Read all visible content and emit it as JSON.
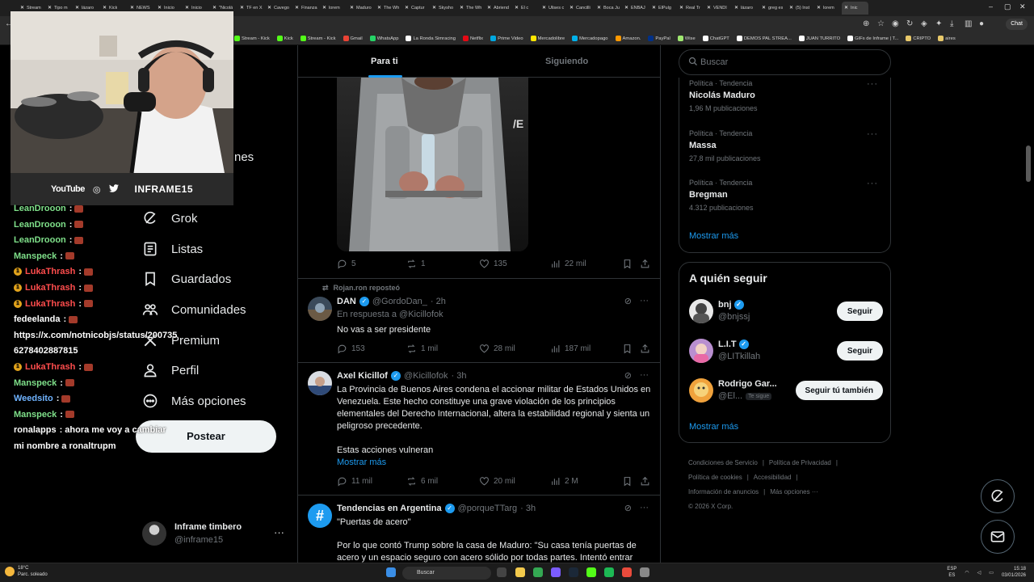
{
  "browser": {
    "tabs": [
      "Stream",
      "Tipo m",
      "lázaro",
      "Kick",
      "NEWS",
      "Inicio",
      "Inicio",
      "\"Nicolá",
      "TF en X",
      "Cavego",
      "Finanza",
      "lorem",
      "Maduro",
      "The Wh",
      "Captur",
      "Skysho",
      "The Wh",
      "Abriend",
      "El c",
      "Ulises c",
      "Cancilli",
      "Boca Ju",
      "ENBAJ",
      "ElPulg",
      "Real Tr",
      "VENDI",
      "lázaro",
      "greg es",
      "(5) Inst",
      "lorem",
      "Inic"
    ],
    "chat_button": "Chat",
    "bookmarks": [
      "Stream - Kick",
      "Kick",
      "Stream - Kick",
      "Gmail",
      "WhatsApp",
      "La Ronda Simracing",
      "Netflix",
      "Prime Video",
      "Mercadolibre",
      "Mercadopago",
      "Amazon.",
      "PayPal",
      "Wise",
      "ChatGPT",
      "DEMOS PAL STREA...",
      "JUAN TURRITO",
      "GIFs de Inframe | T...",
      "CRIPTO",
      "aires"
    ],
    "bookmark_colors": [
      "#53fc18",
      "#53fc18",
      "#53fc18",
      "#ea4335",
      "#25d366",
      "#ffffff",
      "#e50914",
      "#00a8e1",
      "#ffe600",
      "#00b1ea",
      "#ff9900",
      "#003087",
      "#9fe870",
      "#ffffff",
      "#ffffff",
      "#ffffff",
      "#ffffff",
      "#e8c96a",
      "#e8c96a"
    ]
  },
  "nav": {
    "partial_label": "nes",
    "items": [
      {
        "label": "Grok",
        "icon": "grok-icon"
      },
      {
        "label": "Listas",
        "icon": "lists-icon"
      },
      {
        "label": "Guardados",
        "icon": "bookmark-icon"
      },
      {
        "label": "Comunidades",
        "icon": "communities-icon"
      },
      {
        "label": "Premium",
        "icon": "x-premium-icon"
      },
      {
        "label": "Perfil",
        "icon": "profile-icon"
      },
      {
        "label": "Más opciones",
        "icon": "more-options-icon"
      }
    ],
    "post_button": "Postear",
    "account": {
      "name": "Inframe timbero",
      "handle": "@inframe15"
    }
  },
  "feed": {
    "tabs": [
      "Para ti",
      "Siguiendo"
    ],
    "tweets": [
      {
        "stats": {
          "replies": "5",
          "reposts": "1",
          "likes": "135",
          "views": "22 mil"
        }
      },
      {
        "repost_label": "Rojan.ron reposteó",
        "name": "DAN",
        "handle": "@GordoDan_",
        "time": "· 2h",
        "reply_to": "En respuesta a @Kicillofok",
        "text": "No vas a ser presidente",
        "stats": {
          "replies": "153",
          "reposts": "1 mil",
          "likes": "28 mil",
          "views": "187 mil"
        }
      },
      {
        "name": "Axel Kicillof",
        "handle": "@Kicillofok",
        "time": "· 3h",
        "text": "La Provincia de Buenos Aires condena el accionar militar de Estados Unidos en Venezuela. Este hecho constituye una grave violación de los principios elementales del Derecho Internacional, altera la estabilidad regional y sienta un peligroso precedente.",
        "text2": "Estas acciones vulneran",
        "show_more": "Mostrar más",
        "stats": {
          "replies": "11 mil",
          "reposts": "6 mil",
          "likes": "20 mil",
          "views": "2 M"
        }
      },
      {
        "name": "Tendencias en Argentina",
        "handle": "@porqueTTarg",
        "time": "· 3h",
        "line1": "\"Puertas de acero\"",
        "line2": "Por lo que contó Trump sobre la casa de Maduro: \"Su casa tenía puertas de acero y un espacio seguro con acero sólido por todas partes. Intentó entrar"
      }
    ]
  },
  "sidebar": {
    "search_placeholder": "Buscar",
    "trends": [
      {
        "category": "Política · Tendencia",
        "title": "Nicolás Maduro",
        "count": "1,96 M publicaciones"
      },
      {
        "category": "Política · Tendencia",
        "title": "Massa",
        "count": "27,8 mil publicaciones"
      },
      {
        "category": "Política · Tendencia",
        "title": "Bregman",
        "count": "4.312 publicaciones"
      }
    ],
    "show_more": "Mostrar más",
    "who_to_follow": {
      "title": "A quién seguir",
      "users": [
        {
          "name": "bnj",
          "handle": "@bnjssj",
          "button": "Seguir"
        },
        {
          "name": "L.I.T",
          "handle": "@LITkillah",
          "button": "Seguir"
        },
        {
          "name": "Rodrigo Gar...",
          "handle": "@El...",
          "follows_you": "Te sigue",
          "button": "Seguir tú también"
        }
      ],
      "show_more": "Mostrar más"
    },
    "footer": {
      "row1": [
        "Condiciones de Servicio",
        "Política de Privacidad"
      ],
      "row2": [
        "Política de cookies",
        "Accesibilidad"
      ],
      "row3": [
        "Información de anuncios",
        "Más opciones ···"
      ],
      "copyright": "© 2026 X Corp."
    }
  },
  "stream": {
    "socials": {
      "youtube": "YouTube",
      "brand": "INFRAME15"
    },
    "chat": [
      {
        "user": "LeanDrooon",
        "color": "green",
        "body": ":"
      },
      {
        "user": "LeanDrooon",
        "color": "green",
        "body": ":"
      },
      {
        "user": "LeanDrooon",
        "color": "green",
        "body": ":"
      },
      {
        "user": "Manspeck",
        "color": "green",
        "body": ":"
      },
      {
        "user": "LukaThrash",
        "color": "red",
        "body": ":"
      },
      {
        "user": "LukaThrash",
        "color": "red",
        "body": ":"
      },
      {
        "user": "LukaThrash",
        "color": "red",
        "body": ":"
      },
      {
        "user": "fedeelanda",
        "color": "white",
        "body": ":"
      },
      {
        "user": "",
        "color": "white",
        "body": "https://x.com/notnicobjs/status/200735"
      },
      {
        "user": "",
        "color": "white",
        "body": "6278402887815"
      },
      {
        "user": "LukaThrash",
        "color": "red",
        "body": ":"
      },
      {
        "user": "Manspeck",
        "color": "green",
        "body": ":"
      },
      {
        "user": "Weedsito",
        "color": "blue",
        "body": ":"
      },
      {
        "user": "Manspeck",
        "color": "green",
        "body": ":"
      },
      {
        "user": "ronalapps",
        "color": "white",
        "body": ": ahora me voy a cambiar"
      },
      {
        "user": "",
        "color": "white",
        "body": "mi nombre a ronaltrupm"
      }
    ]
  },
  "taskbar": {
    "weather_temp": "18°C",
    "weather_desc": "Parc. soleado",
    "search": "Buscar",
    "lang1": "ESP",
    "lang2": "ES",
    "time": "15:18",
    "date": "03/01/2026"
  }
}
